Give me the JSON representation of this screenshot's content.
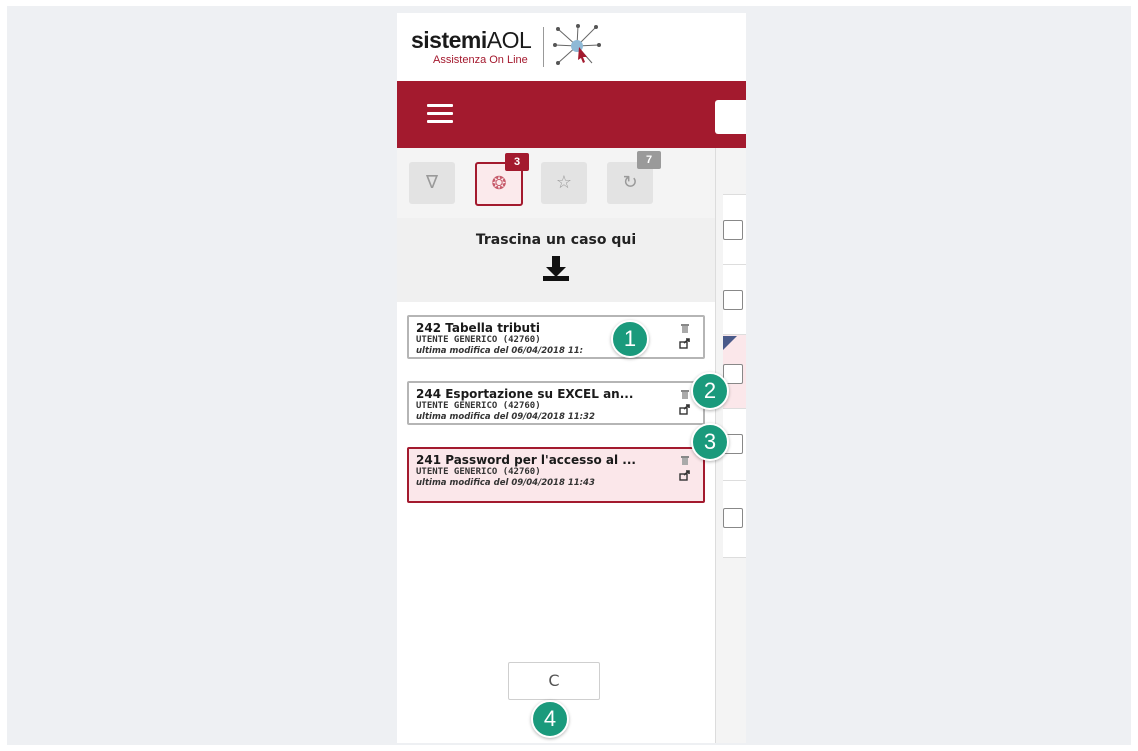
{
  "app": {
    "brand_bold": "sistemi",
    "brand_light": "AOL",
    "brand_sub": "Assistenza On Line"
  },
  "filters": {
    "items": [
      {
        "name": "filter-icon",
        "glyph": "∇",
        "badge": ""
      },
      {
        "name": "active-cases-icon",
        "glyph": "❂",
        "badge": "3"
      },
      {
        "name": "star-icon",
        "glyph": "☆",
        "badge": ""
      },
      {
        "name": "history-icon",
        "glyph": "↻",
        "badge": "7"
      }
    ]
  },
  "drop_zone": {
    "label": "Trascina un caso qui"
  },
  "cases": [
    {
      "title": "242 Tabella tributi",
      "user": "UTENTE GENERICO (42760)",
      "modified": "ultima modifica del 06/04/2018 11:",
      "selected": false
    },
    {
      "title": "244 Esportazione su EXCEL an...",
      "user": "UTENTE GENERICO (42760)",
      "modified": "ultima modifica del 09/04/2018 11:32",
      "selected": false
    },
    {
      "title": "241 Password per l'accesso al ...",
      "user": "UTENTE GENERICO (42760)",
      "modified": "ultima modifica del 09/04/2018 11:43",
      "selected": true
    }
  ],
  "refresh": {
    "glyph": "C"
  },
  "markers": [
    "1",
    "2",
    "3",
    "4"
  ],
  "colors": {
    "brand_red": "#a31a2e",
    "marker_green": "#1a9a7c"
  }
}
